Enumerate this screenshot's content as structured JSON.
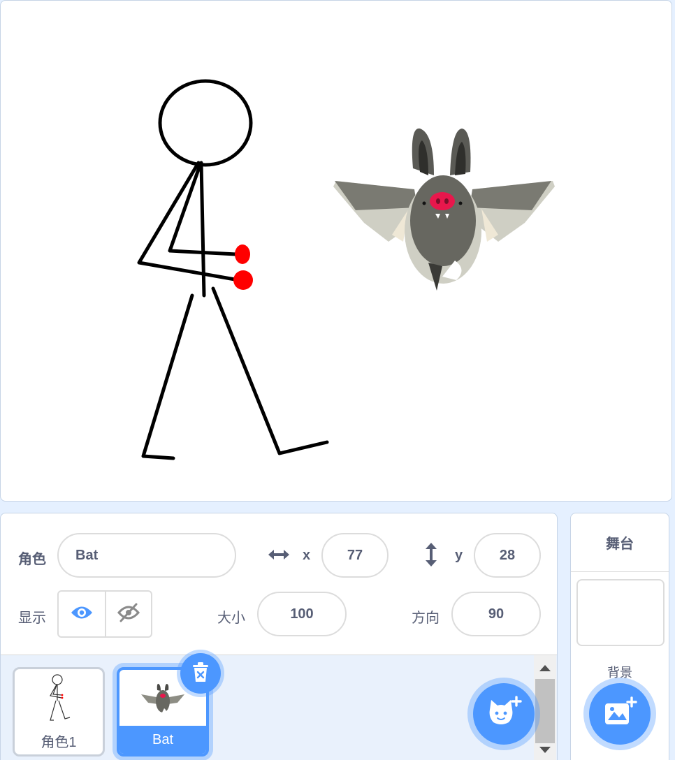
{
  "sprite_info": {
    "sprite_label": "角色",
    "sprite_name": "Bat",
    "x_label": "x",
    "x_value": "77",
    "y_label": "y",
    "y_value": "28",
    "show_label": "显示",
    "size_label": "大小",
    "size_value": "100",
    "direction_label": "方向",
    "direction_value": "90"
  },
  "sprites": [
    {
      "name": "角色1",
      "selected": false
    },
    {
      "name": "Bat",
      "selected": true
    }
  ],
  "stage_panel": {
    "title": "舞台",
    "backdrop_label": "背景"
  },
  "icons": {
    "x_axis": "horizontal-arrows-icon",
    "y_axis": "vertical-arrows-icon",
    "show": "eye-icon",
    "hide": "eye-slash-icon",
    "delete": "trash-icon",
    "add_sprite": "cat-plus-icon",
    "add_backdrop": "image-plus-icon"
  },
  "colors": {
    "accent": "#4c97ff",
    "text": "#575e75",
    "panel_bg": "#e5f0ff"
  }
}
